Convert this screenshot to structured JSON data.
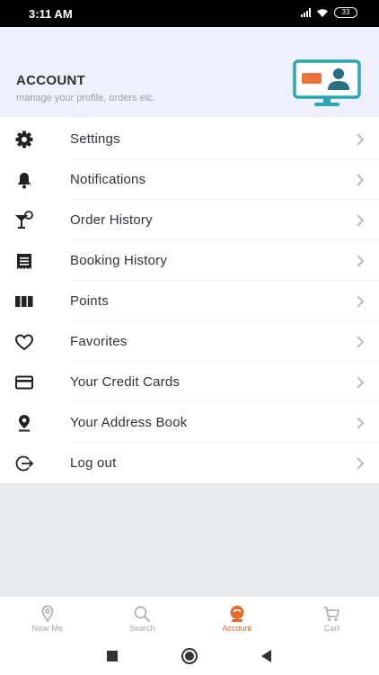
{
  "status_bar": {
    "time": "3:11 AM",
    "battery": "33"
  },
  "header": {
    "title": "ACCOUNT",
    "subtitle": "manage your profile, orders etc.",
    "illustration_icon": "profile-monitor-icon"
  },
  "menu": {
    "items": [
      {
        "label": "Settings",
        "icon": "gear-icon"
      },
      {
        "label": "Notifications",
        "icon": "bell-icon"
      },
      {
        "label": "Order History",
        "icon": "cocktail-icon"
      },
      {
        "label": "Booking History",
        "icon": "receipt-icon"
      },
      {
        "label": "Points",
        "icon": "columns-icon"
      },
      {
        "label": "Favorites",
        "icon": "heart-icon"
      },
      {
        "label": "Your Credit Cards",
        "icon": "credit-card-icon"
      },
      {
        "label": "Your Address Book",
        "icon": "location-pin-icon"
      },
      {
        "label": "Log out",
        "icon": "logout-icon"
      }
    ]
  },
  "tabbar": {
    "tabs": [
      {
        "label": "Near Me",
        "icon": "map-pin-icon"
      },
      {
        "label": "Search",
        "icon": "search-icon"
      },
      {
        "label": "Account",
        "icon": "account-icon",
        "active": true
      },
      {
        "label": "Cart",
        "icon": "cart-icon"
      }
    ]
  },
  "colors": {
    "accent": "#e36a2d",
    "illustration": "#2aa6b7",
    "header_bg": "#eef1fb"
  }
}
